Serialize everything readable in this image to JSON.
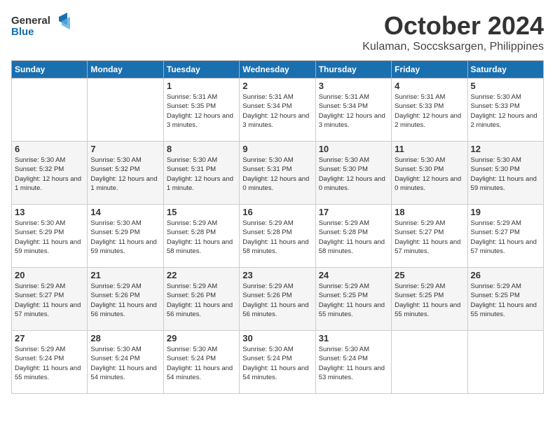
{
  "logo": {
    "line1": "General",
    "line2": "Blue"
  },
  "title": "October 2024",
  "location": "Kulaman, Soccsksargen, Philippines",
  "days_of_week": [
    "Sunday",
    "Monday",
    "Tuesday",
    "Wednesday",
    "Thursday",
    "Friday",
    "Saturday"
  ],
  "weeks": [
    [
      {
        "day": "",
        "info": ""
      },
      {
        "day": "",
        "info": ""
      },
      {
        "day": "1",
        "info": "Sunrise: 5:31 AM\nSunset: 5:35 PM\nDaylight: 12 hours and 3 minutes."
      },
      {
        "day": "2",
        "info": "Sunrise: 5:31 AM\nSunset: 5:34 PM\nDaylight: 12 hours and 3 minutes."
      },
      {
        "day": "3",
        "info": "Sunrise: 5:31 AM\nSunset: 5:34 PM\nDaylight: 12 hours and 3 minutes."
      },
      {
        "day": "4",
        "info": "Sunrise: 5:31 AM\nSunset: 5:33 PM\nDaylight: 12 hours and 2 minutes."
      },
      {
        "day": "5",
        "info": "Sunrise: 5:30 AM\nSunset: 5:33 PM\nDaylight: 12 hours and 2 minutes."
      }
    ],
    [
      {
        "day": "6",
        "info": "Sunrise: 5:30 AM\nSunset: 5:32 PM\nDaylight: 12 hours and 1 minute."
      },
      {
        "day": "7",
        "info": "Sunrise: 5:30 AM\nSunset: 5:32 PM\nDaylight: 12 hours and 1 minute."
      },
      {
        "day": "8",
        "info": "Sunrise: 5:30 AM\nSunset: 5:31 PM\nDaylight: 12 hours and 1 minute."
      },
      {
        "day": "9",
        "info": "Sunrise: 5:30 AM\nSunset: 5:31 PM\nDaylight: 12 hours and 0 minutes."
      },
      {
        "day": "10",
        "info": "Sunrise: 5:30 AM\nSunset: 5:30 PM\nDaylight: 12 hours and 0 minutes."
      },
      {
        "day": "11",
        "info": "Sunrise: 5:30 AM\nSunset: 5:30 PM\nDaylight: 12 hours and 0 minutes."
      },
      {
        "day": "12",
        "info": "Sunrise: 5:30 AM\nSunset: 5:30 PM\nDaylight: 11 hours and 59 minutes."
      }
    ],
    [
      {
        "day": "13",
        "info": "Sunrise: 5:30 AM\nSunset: 5:29 PM\nDaylight: 11 hours and 59 minutes."
      },
      {
        "day": "14",
        "info": "Sunrise: 5:30 AM\nSunset: 5:29 PM\nDaylight: 11 hours and 59 minutes."
      },
      {
        "day": "15",
        "info": "Sunrise: 5:29 AM\nSunset: 5:28 PM\nDaylight: 11 hours and 58 minutes."
      },
      {
        "day": "16",
        "info": "Sunrise: 5:29 AM\nSunset: 5:28 PM\nDaylight: 11 hours and 58 minutes."
      },
      {
        "day": "17",
        "info": "Sunrise: 5:29 AM\nSunset: 5:28 PM\nDaylight: 11 hours and 58 minutes."
      },
      {
        "day": "18",
        "info": "Sunrise: 5:29 AM\nSunset: 5:27 PM\nDaylight: 11 hours and 57 minutes."
      },
      {
        "day": "19",
        "info": "Sunrise: 5:29 AM\nSunset: 5:27 PM\nDaylight: 11 hours and 57 minutes."
      }
    ],
    [
      {
        "day": "20",
        "info": "Sunrise: 5:29 AM\nSunset: 5:27 PM\nDaylight: 11 hours and 57 minutes."
      },
      {
        "day": "21",
        "info": "Sunrise: 5:29 AM\nSunset: 5:26 PM\nDaylight: 11 hours and 56 minutes."
      },
      {
        "day": "22",
        "info": "Sunrise: 5:29 AM\nSunset: 5:26 PM\nDaylight: 11 hours and 56 minutes."
      },
      {
        "day": "23",
        "info": "Sunrise: 5:29 AM\nSunset: 5:26 PM\nDaylight: 11 hours and 56 minutes."
      },
      {
        "day": "24",
        "info": "Sunrise: 5:29 AM\nSunset: 5:25 PM\nDaylight: 11 hours and 55 minutes."
      },
      {
        "day": "25",
        "info": "Sunrise: 5:29 AM\nSunset: 5:25 PM\nDaylight: 11 hours and 55 minutes."
      },
      {
        "day": "26",
        "info": "Sunrise: 5:29 AM\nSunset: 5:25 PM\nDaylight: 11 hours and 55 minutes."
      }
    ],
    [
      {
        "day": "27",
        "info": "Sunrise: 5:29 AM\nSunset: 5:24 PM\nDaylight: 11 hours and 55 minutes."
      },
      {
        "day": "28",
        "info": "Sunrise: 5:30 AM\nSunset: 5:24 PM\nDaylight: 11 hours and 54 minutes."
      },
      {
        "day": "29",
        "info": "Sunrise: 5:30 AM\nSunset: 5:24 PM\nDaylight: 11 hours and 54 minutes."
      },
      {
        "day": "30",
        "info": "Sunrise: 5:30 AM\nSunset: 5:24 PM\nDaylight: 11 hours and 54 minutes."
      },
      {
        "day": "31",
        "info": "Sunrise: 5:30 AM\nSunset: 5:24 PM\nDaylight: 11 hours and 53 minutes."
      },
      {
        "day": "",
        "info": ""
      },
      {
        "day": "",
        "info": ""
      }
    ]
  ]
}
